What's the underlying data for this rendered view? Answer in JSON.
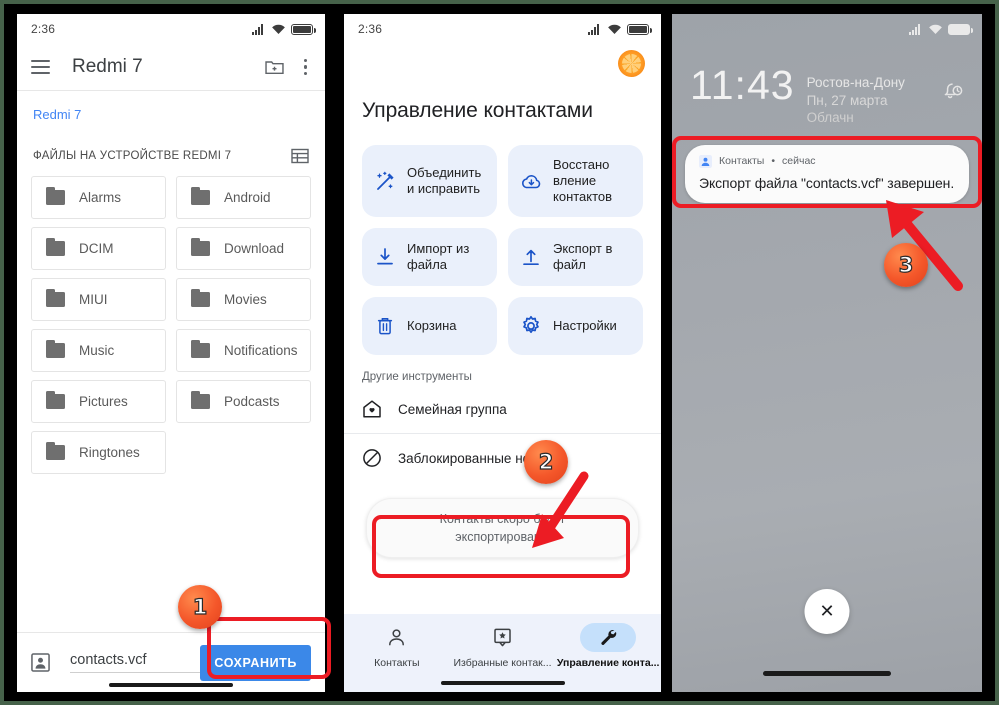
{
  "panels": {
    "files": {
      "status": {
        "time": "2:36"
      },
      "appbar": {
        "title": "Redmi 7",
        "menu_icon": "hamburger-icon",
        "new_folder_icon": "new-folder-icon",
        "overflow_icon": "three-dots-icon"
      },
      "breadcrumb": "Redmi 7",
      "section_label": "ФАЙЛЫ НА УСТРОЙСТВЕ REDMI 7",
      "view_toggle_icon": "list-view-icon",
      "folders": [
        "Alarms",
        "Android",
        "DCIM",
        "Download",
        "MIUI",
        "Movies",
        "Music",
        "Notifications",
        "Pictures",
        "Podcasts",
        "Ringtones"
      ],
      "save_bar": {
        "file_icon": "contact-card-icon",
        "filename": "contacts.vcf",
        "save_label": "СОХРАНИТЬ",
        "save_color": "#3b88e8"
      }
    },
    "contacts": {
      "status": {
        "time": "2:36"
      },
      "avatar_icon": "orange-slice-avatar",
      "title": "Управление контактами",
      "tiles": [
        {
          "label": "Объединить\nи исправить",
          "icon": "magic-wand-icon"
        },
        {
          "label": "Восстано\nвление\nконтактов",
          "icon": "cloud-download-icon"
        },
        {
          "label": "Импорт из\nфайла",
          "icon": "import-icon"
        },
        {
          "label": "Экспорт в\nфайл",
          "icon": "export-icon"
        },
        {
          "label": "Корзина",
          "icon": "trash-icon"
        },
        {
          "label": "Настройки",
          "icon": "gear-icon"
        }
      ],
      "other_tools_label": "Другие инструменты",
      "tools": [
        {
          "label": "Семейная группа",
          "icon": "home-heart-icon"
        },
        {
          "label": "Заблокированные номера",
          "icon": "blocked-icon"
        }
      ],
      "toast": "Контакты скоро будут\nэкспортированы",
      "nav": [
        {
          "label": "Контакты",
          "icon": "person-icon",
          "active": false
        },
        {
          "label": "Избранные контак...",
          "icon": "star-badge-icon",
          "active": false
        },
        {
          "label": "Управление конта...",
          "icon": "wrench-icon",
          "active": true
        }
      ]
    },
    "lock": {
      "status": {},
      "time": "11:43",
      "city": "Ростов-на-Дону",
      "date": "Пн, 27 марта",
      "weather": "Облачн",
      "bell_icon": "bell-clock-icon",
      "notification": {
        "app_icon": "contacts-app-icon",
        "app": "Контакты",
        "separator": "•",
        "when": "сейчас",
        "text": "Экспорт файла \"contacts.vcf\" завершен."
      },
      "dismiss_icon": "close-icon",
      "dismiss_label": "✕"
    }
  },
  "annotations": {
    "steps": [
      "1",
      "2",
      "3"
    ],
    "highlight_color": "#ec1c24",
    "badge_color": "#f4572a"
  }
}
